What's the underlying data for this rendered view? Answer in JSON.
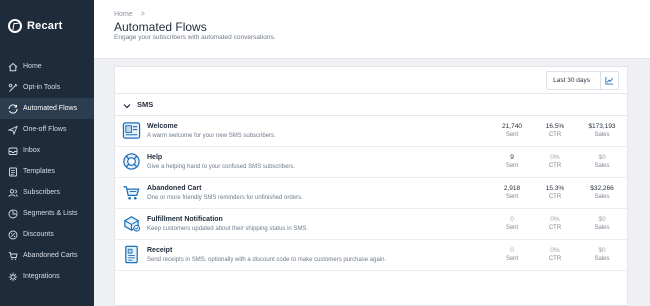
{
  "brand": {
    "name": "Recart"
  },
  "sidebar": {
    "items": [
      {
        "label": "Home",
        "icon": "home-icon",
        "active": false
      },
      {
        "label": "Opt-in Tools",
        "icon": "tools-icon",
        "active": false
      },
      {
        "label": "Automated Flows",
        "icon": "flows-icon",
        "active": true
      },
      {
        "label": "One-off Flows",
        "icon": "send-icon",
        "active": false
      },
      {
        "label": "Inbox",
        "icon": "inbox-icon",
        "active": false
      },
      {
        "label": "Templates",
        "icon": "templates-icon",
        "active": false
      },
      {
        "label": "Subscribers",
        "icon": "users-icon",
        "active": false
      },
      {
        "label": "Segments & Lists",
        "icon": "segments-icon",
        "active": false
      },
      {
        "label": "Discounts",
        "icon": "discount-icon",
        "active": false
      },
      {
        "label": "Abandoned Carts",
        "icon": "cart-icon",
        "active": false
      },
      {
        "label": "Integrations",
        "icon": "integrations-icon",
        "active": false
      }
    ]
  },
  "header": {
    "breadcrumb": "Home",
    "breadcrumb_separator": ">",
    "title": "Automated Flows",
    "subtitle": "Engage your subscribers with automated conversations."
  },
  "toolbar": {
    "date_range": "Last 30 days",
    "chart_icon": "chart-icon"
  },
  "section": {
    "label": "SMS",
    "icon": "chevron-down-icon"
  },
  "flows": [
    {
      "name": "Welcome",
      "desc": "A warm welcome for your new SMS subscribers.",
      "icon": "welcome-icon",
      "sent": "21,740",
      "ctr": "16.5%",
      "sales": "$173,193",
      "active": true
    },
    {
      "name": "Help",
      "desc": "Give a helping hand to your confused SMS subscribers.",
      "icon": "help-icon",
      "sent": "9",
      "ctr": "0%",
      "sales": "$0",
      "active": true
    },
    {
      "name": "Abandoned Cart",
      "desc": "One or more friendly SMS reminders for unfinished orders.",
      "icon": "cart-icon",
      "sent": "2,918",
      "ctr": "15.3%",
      "sales": "$32,266",
      "active": true
    },
    {
      "name": "Fulfillment Notification",
      "desc": "Keep customers updated about their shipping status in SMS.",
      "icon": "fulfillment-icon",
      "sent": "0",
      "ctr": "0%",
      "sales": "$0",
      "active": false
    },
    {
      "name": "Receipt",
      "desc": "Send receipts in SMS, optionally with a discount code to make customers purchase again.",
      "icon": "receipt-icon",
      "sent": "0",
      "ctr": "0%",
      "sales": "$0",
      "active": false
    }
  ],
  "stat_labels": {
    "sent": "Sent",
    "ctr": "CTR",
    "sales": "Sales"
  },
  "colors": {
    "sidebar_bg": "#1d2b3a",
    "active_bg": "#2d3d50",
    "icon_blue": "#1a6fb8",
    "page_bg": "#eef0f3"
  }
}
